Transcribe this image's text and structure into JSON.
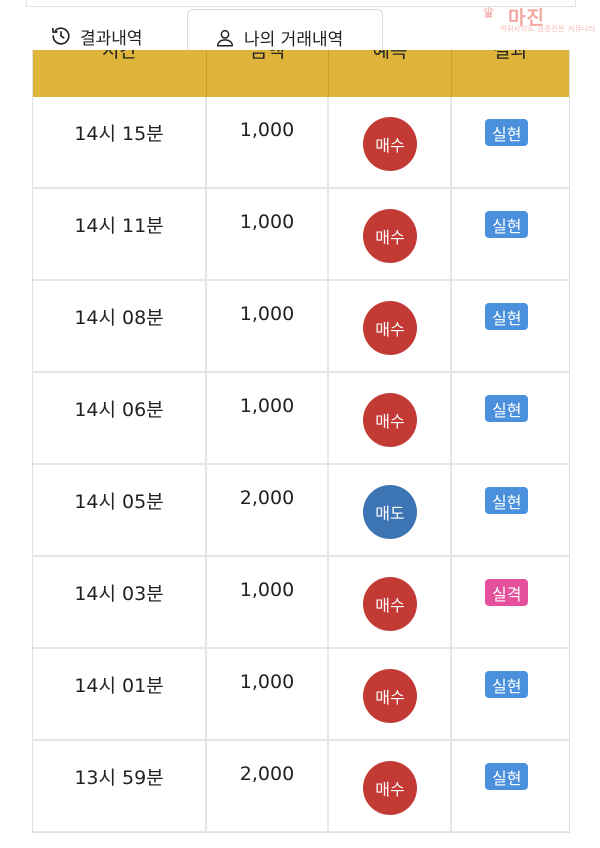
{
  "tabs": [
    {
      "label": "결과내역",
      "icon": "history-icon"
    },
    {
      "label": "나의 거래내역",
      "icon": "user-icon"
    }
  ],
  "watermark": {
    "name": "마진",
    "tagline": "먹튀사이트 검증전문 커뮤니티"
  },
  "table": {
    "headers": [
      "시간",
      "금액",
      "예측",
      "결과"
    ],
    "rows": [
      {
        "time": "14시 15분",
        "amount": "1,000",
        "side": "매수",
        "side_type": "buy",
        "result": "실현",
        "result_type": "win"
      },
      {
        "time": "14시 11분",
        "amount": "1,000",
        "side": "매수",
        "side_type": "buy",
        "result": "실현",
        "result_type": "win"
      },
      {
        "time": "14시 08분",
        "amount": "1,000",
        "side": "매수",
        "side_type": "buy",
        "result": "실현",
        "result_type": "win"
      },
      {
        "time": "14시 06분",
        "amount": "1,000",
        "side": "매수",
        "side_type": "buy",
        "result": "실현",
        "result_type": "win"
      },
      {
        "time": "14시 05분",
        "amount": "2,000",
        "side": "매도",
        "side_type": "sell",
        "result": "실현",
        "result_type": "win"
      },
      {
        "time": "14시 03분",
        "amount": "1,000",
        "side": "매수",
        "side_type": "buy",
        "result": "실격",
        "result_type": "loss"
      },
      {
        "time": "14시 01분",
        "amount": "1,000",
        "side": "매수",
        "side_type": "buy",
        "result": "실현",
        "result_type": "win"
      },
      {
        "time": "13시 59분",
        "amount": "2,000",
        "side": "매수",
        "side_type": "buy",
        "result": "실현",
        "result_type": "win"
      }
    ]
  },
  "colors": {
    "header_bg": "#dfb43a",
    "buy": "#c23a33",
    "sell": "#3d74b4",
    "win": "#4a90dc",
    "loss": "#e4509c"
  }
}
